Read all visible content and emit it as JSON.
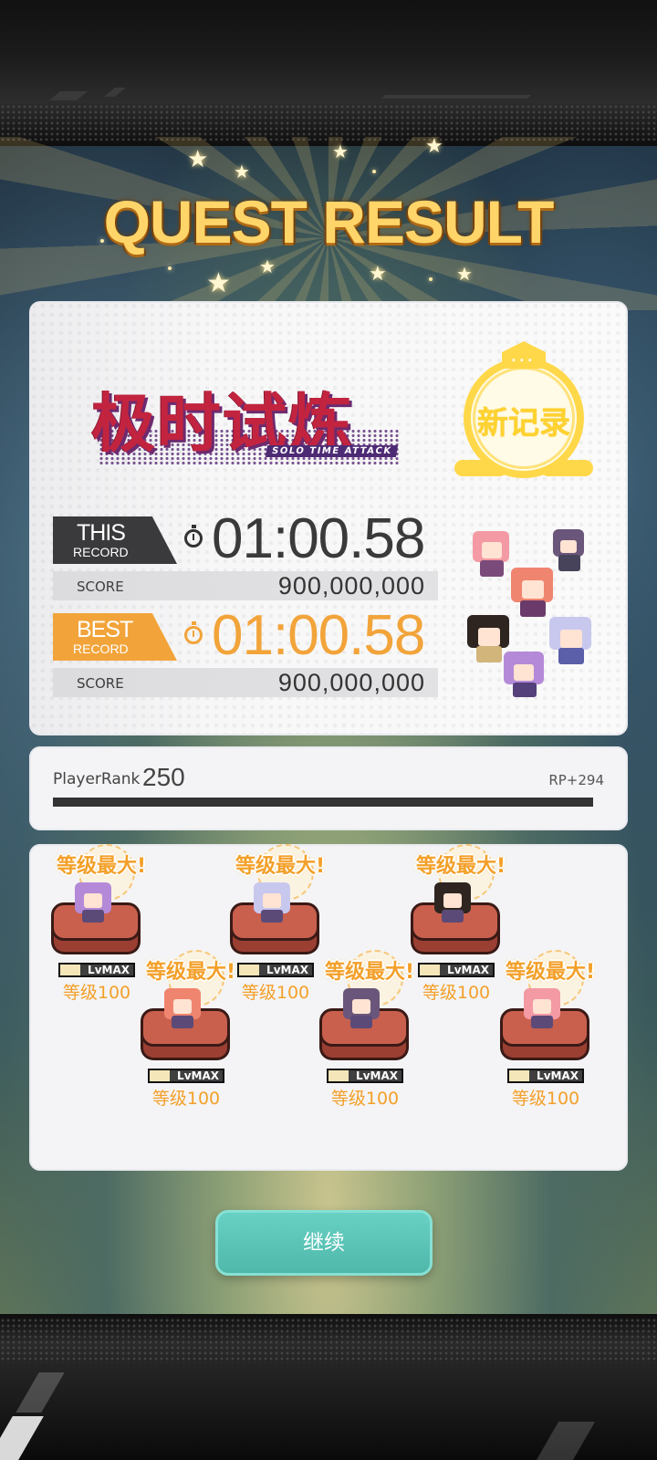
{
  "header": {
    "title": "QUEST RESULT"
  },
  "mode": {
    "title_cn": "极时试炼",
    "subtitle_en": "SOLO TIME ATTACK"
  },
  "new_record_badge": {
    "text": "新记录"
  },
  "this_record": {
    "tag_big": "THIS",
    "tag_small": "RECORD",
    "time": "01:00.58",
    "score_label": "SCORE",
    "score": "900,000,000"
  },
  "best_record": {
    "tag_big": "BEST",
    "tag_small": "RECORD",
    "time": "01:00.58",
    "score_label": "SCORE",
    "score": "900,000,000"
  },
  "player_rank": {
    "label": "PlayerRank",
    "value": "250",
    "rp": "RP+294",
    "progress": 1.0
  },
  "team": [
    {
      "max_label": "等级最大!",
      "lv_badge": "LvMAX",
      "level": "等级100",
      "hair": "#b48ad8"
    },
    {
      "max_label": "等级最大!",
      "lv_badge": "LvMAX",
      "level": "等级100",
      "hair": "#f0856f"
    },
    {
      "max_label": "等级最大!",
      "lv_badge": "LvMAX",
      "level": "等级100",
      "hair": "#c8c8ee"
    },
    {
      "max_label": "等级最大!",
      "lv_badge": "LvMAX",
      "level": "等级100",
      "hair": "#6a567a"
    },
    {
      "max_label": "等级最大!",
      "lv_badge": "LvMAX",
      "level": "等级100",
      "hair": "#2e2520"
    },
    {
      "max_label": "等级最大!",
      "lv_badge": "LvMAX",
      "level": "等级100",
      "hair": "#f39aa4"
    }
  ],
  "continue_button": {
    "label": "继续"
  },
  "colors": {
    "best_accent": "#f2a43a",
    "this_accent": "#3a3a3c",
    "button": "#5cc4b6",
    "gold": "#ffd56a"
  }
}
